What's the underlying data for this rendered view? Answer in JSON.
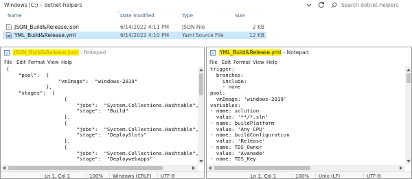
{
  "explorer": {
    "path": [
      "Windows (C:)",
      "dotnet-helpers"
    ],
    "search_placeholder": "Search dotnet-helpers",
    "columns": {
      "name": "Name",
      "date": "Date modified",
      "type": "Type",
      "size": "Size"
    },
    "files": [
      {
        "name": "JSON_Build&Release.json",
        "date": "6/14/2022 4:11 PM",
        "type": "JSON File",
        "size": "2 KB",
        "selected": false
      },
      {
        "name": "YML_Build&Release.yml",
        "date": "6/14/2022 4:10 PM",
        "type": "Yaml Source File",
        "size": "12 KB",
        "selected": true
      }
    ]
  },
  "json_window": {
    "file_name": "JSON_Build&Release.json",
    "app_name": " - Notepad",
    "menu": [
      "File",
      "Edit",
      "Format",
      "View",
      "Help"
    ],
    "lines": [
      "{",
      "    \"pool\":  {",
      "                 \"vmImage\":  \"windows-2019\"",
      "             },",
      "    \"stages\":  [",
      "                   {",
      "                       \"jobs\":  \"System.Collections.Hashtable\",",
      "                       \"stage\":  \"Build\"",
      "                   },",
      "                   {",
      "                       \"jobs\":  \"System.Collections.Hashtable\",",
      "                       \"stage\":  \"DeploySlots\"",
      "                   },",
      "                   {",
      "                       \"jobs\":  \"System.Collections.Hashtable\",",
      "                       \"stage\":  \"Deploywebapps\""
    ],
    "status": {
      "position": "Ln 1, Col 1",
      "zoom": "100%",
      "line_ending": "Windows (CRLF)",
      "encoding": "UTF-8"
    }
  },
  "yml_window": {
    "file_name": "YML_Build&Release.yml",
    "app_name": " - Notepad",
    "menu": [
      "File",
      "Edit",
      "Format",
      "View",
      "Help"
    ],
    "lines": [
      "trigger:",
      "  branches:",
      "    include:",
      "    - none",
      "pool:",
      "  vmImage: 'windows-2019'",
      "variables:",
      "- name: solution",
      "  value: '**/*.sln'",
      "- name: buildPlatform",
      "  value: 'Any CPU'",
      "- name: buildConfiguration",
      "  value: 'Release'",
      "- name: TDS_Owner",
      "  value: 'Avanade'",
      "- name: TDS_Key"
    ],
    "status": {
      "position": "Ln 1, Col 1",
      "zoom": "100%",
      "line_ending": "Unix (LF)",
      "encoding": "UTF-8"
    }
  },
  "colors": {
    "highlight": "#ffee00",
    "selection": "#cce8ff",
    "header_text": "#4c607a"
  }
}
